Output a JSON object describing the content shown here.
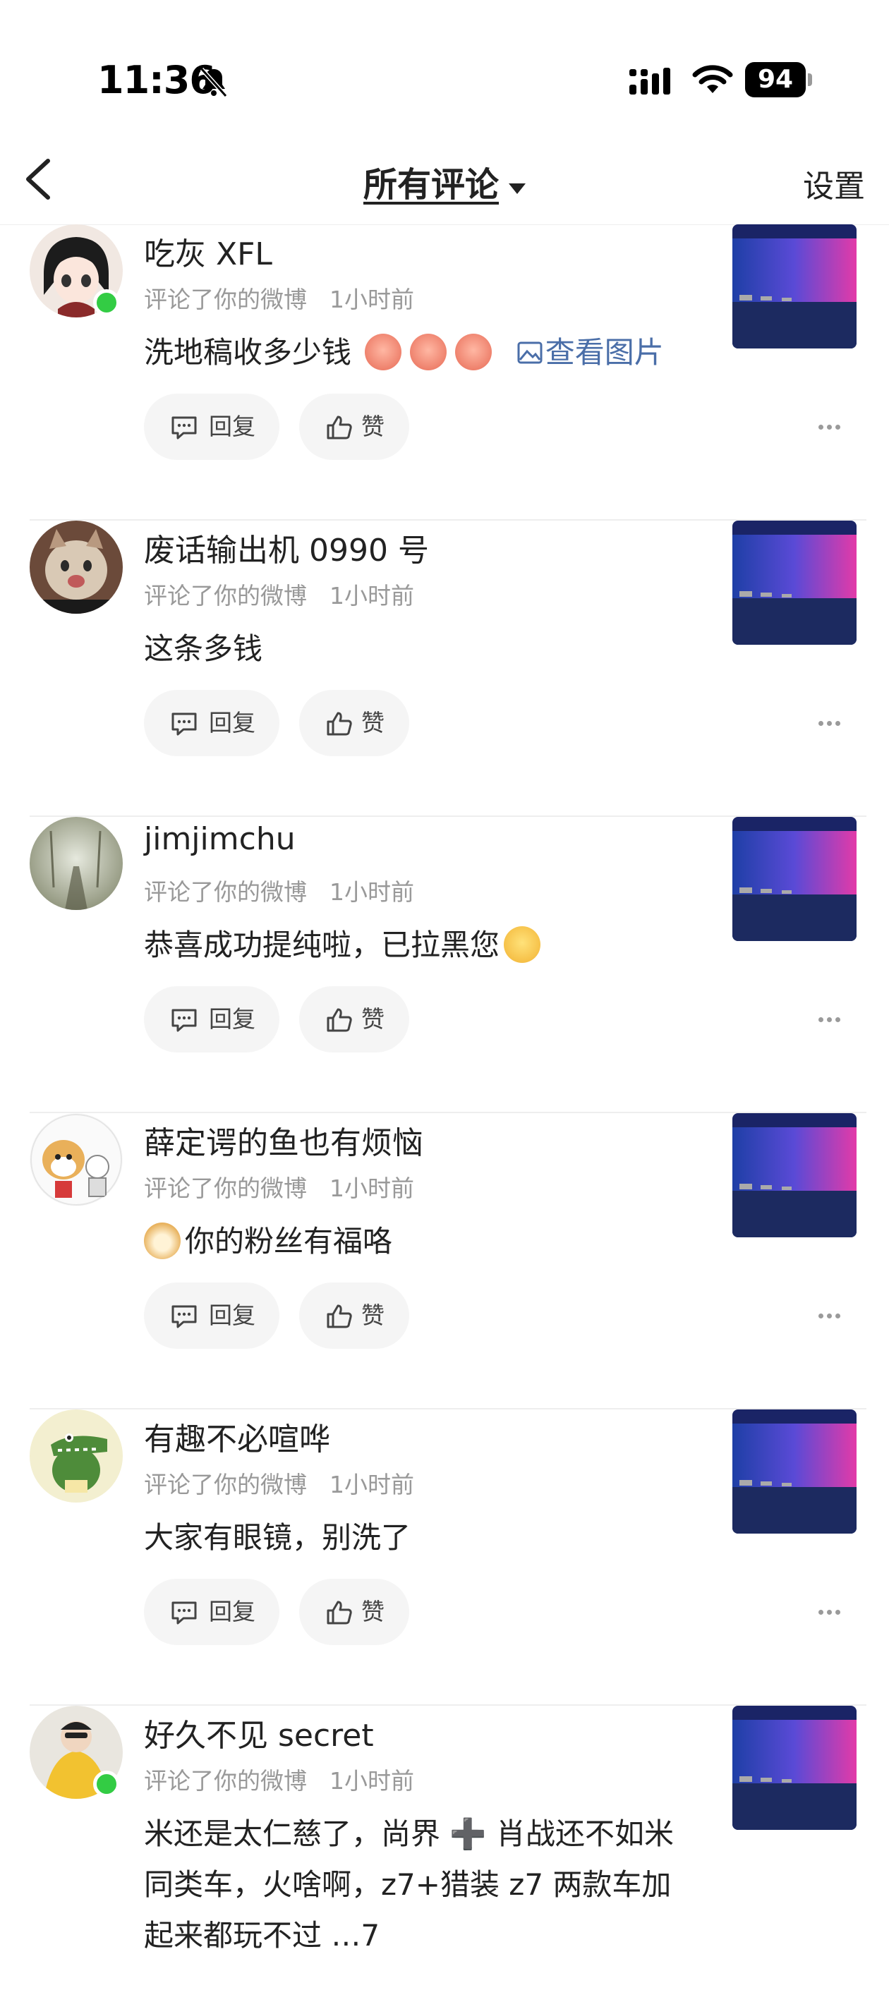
{
  "status_bar": {
    "time": "11:36",
    "battery": "94",
    "icons": [
      "bell-slash-icon",
      "signal-icon",
      "wifi-icon",
      "battery-icon"
    ]
  },
  "header": {
    "title": "所有评论",
    "settings": "设置"
  },
  "labels": {
    "reply": "回复",
    "like": "赞"
  },
  "comments": [
    {
      "name": "吃灰 XFL",
      "action": "评论了你的微博",
      "time": "1小时前",
      "text": "洗地稿收多少钱",
      "link": "查看图片",
      "online": true
    },
    {
      "name": "废话输出机 0990 号",
      "action": "评论了你的微博",
      "time": "1小时前",
      "text": "这条多钱"
    },
    {
      "name": "jimjimchu",
      "action": "评论了你的微博",
      "time": "1小时前",
      "text": "恭喜成功提纯啦，已拉黑您"
    },
    {
      "name": "薛定谔的鱼也有烦恼",
      "action": "评论了你的微博",
      "time": "1小时前",
      "text": "你的粉丝有福咯"
    },
    {
      "name": "有趣不必喧哗",
      "action": "评论了你的微博",
      "time": "1小时前",
      "text": "大家有眼镜，别洗了"
    },
    {
      "name": "好久不见 secret",
      "action": "评论了你的微博",
      "time": "1小时前",
      "text": "米还是太仁慈了，尚界 ➕ 肖战还不如米同类车，火啥啊，z7+猎装 z7 两款车加起来都玩不过 …7",
      "online": true
    }
  ],
  "colors": {
    "link": "#4a6ea8",
    "online": "#33cc44",
    "meta": "#999999"
  }
}
